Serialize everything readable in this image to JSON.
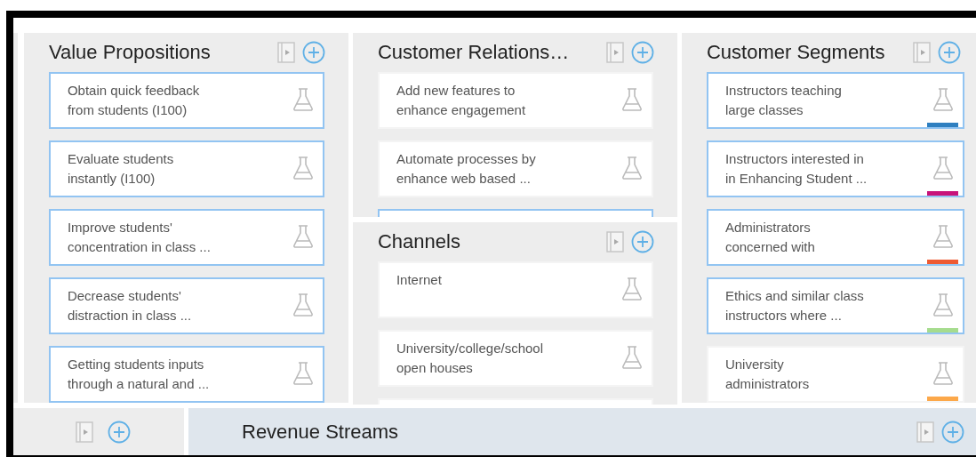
{
  "value_propositions": {
    "title": "Value Propositions",
    "cards": [
      {
        "text": "Obtain quick feedback\nfrom students (I100)",
        "selected": true
      },
      {
        "text": "Evaluate students\ninstantly (I100)",
        "selected": true
      },
      {
        "text": "Improve students'\nconcentration in class ...",
        "selected": true
      },
      {
        "text": "Decrease students'\ndistraction in class ...",
        "selected": true
      },
      {
        "text": "Getting students inputs\nthrough a natural and ...",
        "selected": true
      }
    ]
  },
  "customer_relationships": {
    "title": "Customer Relations…",
    "cards": [
      {
        "text": "Add new features to\nenhance engagement",
        "selected": false
      },
      {
        "text": "Automate processes by\nenhance web based ...",
        "selected": false
      },
      {
        "selected": true
      }
    ]
  },
  "channels": {
    "title": "Channels",
    "cards": [
      {
        "text": "Internet",
        "selected": false
      },
      {
        "text": "University/college/school\nopen houses",
        "selected": false
      },
      {
        "selected": false
      }
    ]
  },
  "customer_segments": {
    "title": "Customer Segments",
    "cards": [
      {
        "text": "Instructors teaching\nlarge classes",
        "selected": true,
        "color": "#2e7fc0"
      },
      {
        "text": "Instructors interested in\nin Enhancing Student ...",
        "selected": true,
        "color": "#c8137a"
      },
      {
        "text": "Administrators\nconcerned with",
        "selected": true,
        "color": "#ee5a32"
      },
      {
        "text": "Ethics and similar class\ninstructors where ...",
        "selected": true,
        "color": "#a6dc8e"
      },
      {
        "text": "University\nadministrators",
        "selected": false,
        "color": "#fca84a"
      }
    ]
  },
  "revenue_streams": {
    "title": "Revenue Streams"
  }
}
